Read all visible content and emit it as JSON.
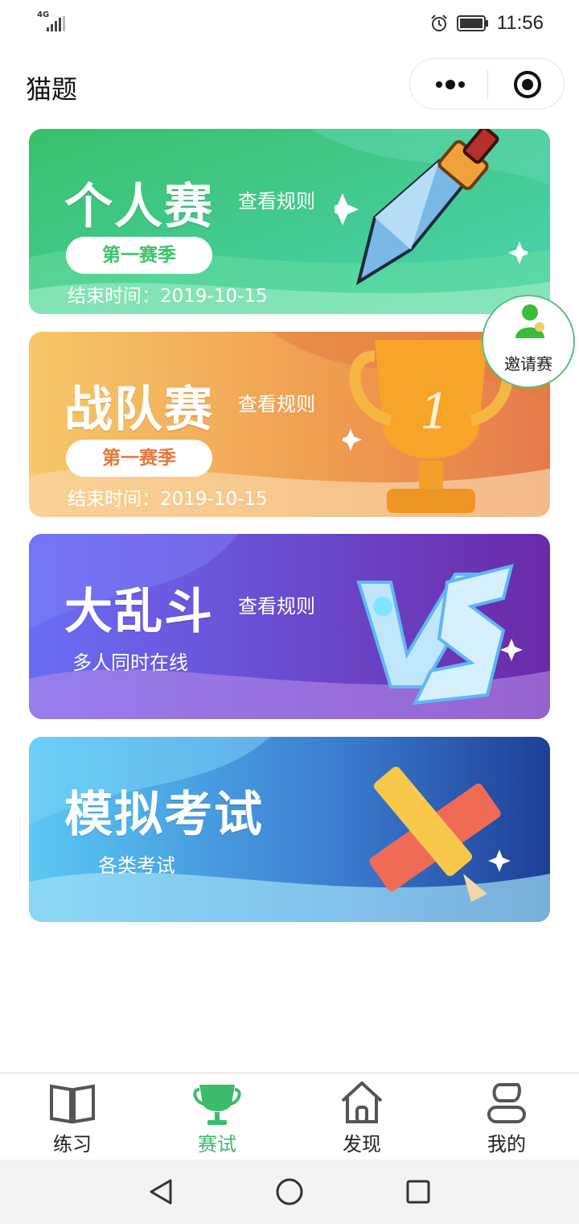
{
  "status_bar": {
    "network": "4G",
    "time": "11:56",
    "icons": [
      "signal-icon",
      "alarm-icon",
      "battery-icon"
    ]
  },
  "nav": {
    "title": "猫题",
    "menu_icon": "more-dots-icon",
    "close_icon": "target-circle-icon"
  },
  "cards": [
    {
      "title": "个人赛",
      "rules_label": "查看规则",
      "season_label": "第一赛季",
      "end_time": "结束时间：2019-10-15",
      "accent": "#3ec46d",
      "icon": "sword-icon"
    },
    {
      "title": "战队赛",
      "rules_label": "查看规则",
      "season_label": "第一赛季",
      "end_time": "结束时间：2019-10-15",
      "accent": "#e8783f",
      "icon": "trophy-icon"
    },
    {
      "title": "大乱斗",
      "rules_label": "查看规则",
      "subtitle": "多人同时在线",
      "icon": "vs-icon"
    },
    {
      "title": "模拟考试",
      "subtitle": "各类考试",
      "icon": "pencil-ruler-icon"
    }
  ],
  "invite": {
    "label": "邀请赛",
    "icon": "user-add-icon"
  },
  "tabs": [
    {
      "label": "练习",
      "icon": "book-icon",
      "active": false
    },
    {
      "label": "赛试",
      "icon": "trophy-tab-icon",
      "active": true
    },
    {
      "label": "发现",
      "icon": "home-icon",
      "active": false
    },
    {
      "label": "我的",
      "icon": "profile-icon",
      "active": false
    }
  ],
  "colors": {
    "active_tab": "#3cbc69",
    "card1": "#3ec46d",
    "card2": "#f2a04a",
    "card3": "#6a5cf0",
    "card4": "#46a6e6"
  }
}
